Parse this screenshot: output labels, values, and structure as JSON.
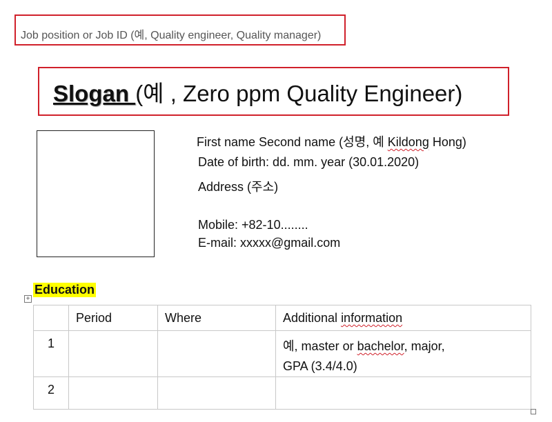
{
  "job": {
    "text": "Job position or Job ID (예, Quality engineer, Quality manager)"
  },
  "slogan": {
    "keyword": "Slogan ",
    "rest": "(예 , Zero ppm Quality Engineer)"
  },
  "profile": {
    "name_prefix": "First name Second name (성명,  예  ",
    "name_given": "Kildong",
    "name_suffix": " Hong)",
    "dob": "Date of birth: dd. mm. year (30.01.2020)",
    "address": "Address (주소)",
    "mobile": "Mobile:  +82-10........",
    "email": "E-mail:  xxxxx@gmail.com"
  },
  "education": {
    "heading": "Education",
    "headers": [
      "",
      "Period",
      "Where",
      "Additional information"
    ],
    "rows": [
      {
        "no": "1",
        "period": "",
        "where": "",
        "info_line1": "예, master or bachelor, major,",
        "info_line2": "GPA (3.4/4.0)"
      },
      {
        "no": "2",
        "period": "",
        "where": "",
        "info_line1": "",
        "info_line2": ""
      }
    ]
  },
  "colors": {
    "box_border": "#d0202a",
    "highlight": "#ffff00",
    "table_border": "#c8c8c8"
  },
  "icons": [
    "table-move-icon",
    "table-resize-handle"
  ]
}
